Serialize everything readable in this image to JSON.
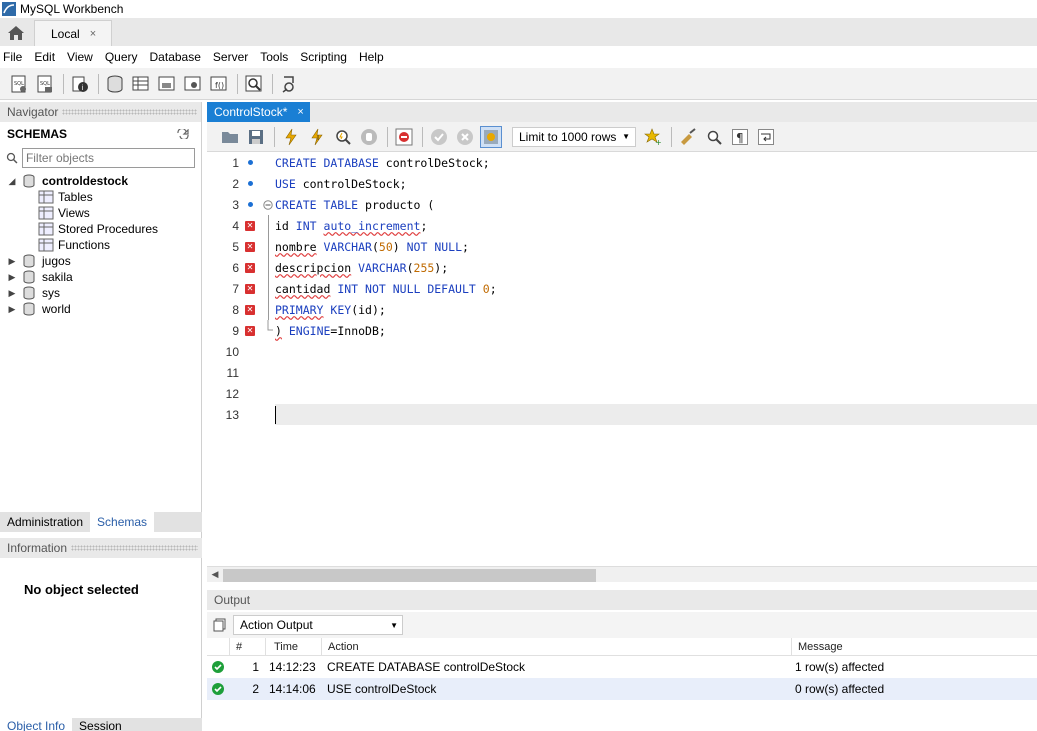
{
  "window": {
    "title": "MySQL Workbench"
  },
  "connection_tab": {
    "label": "Local",
    "close": "×"
  },
  "menu": [
    "File",
    "Edit",
    "View",
    "Query",
    "Database",
    "Server",
    "Tools",
    "Scripting",
    "Help"
  ],
  "navigator": {
    "header": "Navigator",
    "schemas_title": "SCHEMAS",
    "filter_placeholder": "Filter objects",
    "schemas": [
      {
        "name": "controldestock",
        "expanded": true,
        "children": [
          "Tables",
          "Views",
          "Stored Procedures",
          "Functions"
        ]
      },
      {
        "name": "jugos"
      },
      {
        "name": "sakila"
      },
      {
        "name": "sys"
      },
      {
        "name": "world"
      }
    ],
    "tabs": [
      "Administration",
      "Schemas"
    ],
    "active_tab": "Schemas"
  },
  "information": {
    "header": "Information",
    "empty_text": "No object selected"
  },
  "bottom_tabs": [
    "Object Info",
    "Session"
  ],
  "editor": {
    "tab_label": "ControlStock*",
    "tab_close": "×",
    "limit_label": "Limit to 1000 rows",
    "lines": [
      {
        "n": "1",
        "marker": "dot"
      },
      {
        "n": "2",
        "marker": "dot"
      },
      {
        "n": "3",
        "marker": "dot"
      },
      {
        "n": "4",
        "marker": "error"
      },
      {
        "n": "5",
        "marker": "error"
      },
      {
        "n": "6",
        "marker": "error"
      },
      {
        "n": "7",
        "marker": "error"
      },
      {
        "n": "8",
        "marker": "error"
      },
      {
        "n": "9",
        "marker": "error"
      },
      {
        "n": "10"
      },
      {
        "n": "11"
      },
      {
        "n": "12"
      },
      {
        "n": "13"
      }
    ],
    "code": {
      "l1": [
        "CREATE DATABASE",
        " controlDeStock;"
      ],
      "l2": [
        "USE",
        " controlDeStock;"
      ],
      "l3": [
        "CREATE TABLE",
        " producto ("
      ],
      "l4": [
        "id",
        "INT",
        "auto_increment",
        ";"
      ],
      "l5": [
        "nombre",
        "VARCHAR",
        "(",
        "50",
        ")",
        "NOT NULL",
        ";"
      ],
      "l6": [
        "descripcion",
        "VARCHAR",
        "(",
        "255",
        ");"
      ],
      "l7": [
        "cantidad",
        "INT NOT NULL DEFAULT",
        "0",
        ";"
      ],
      "l8": [
        "PRIMARY",
        "KEY",
        "(id);"
      ],
      "l9": [
        ")",
        "ENGINE",
        "=InnoDB;"
      ]
    }
  },
  "output": {
    "header": "Output",
    "mode": "Action Output",
    "columns": [
      "#",
      "Time",
      "Action",
      "Message"
    ],
    "rows": [
      {
        "num": "1",
        "time": "14:12:23",
        "action": "CREATE DATABASE controlDeStock",
        "message": "1 row(s) affected"
      },
      {
        "num": "2",
        "time": "14:14:06",
        "action": "USE controlDeStock",
        "message": "0 row(s) affected"
      }
    ]
  },
  "colors": {
    "accent": "#1a7fd4",
    "keyword": "#1b3fbf",
    "number": "#c06a00",
    "error": "#d83030",
    "ok": "#1e9f3a"
  }
}
